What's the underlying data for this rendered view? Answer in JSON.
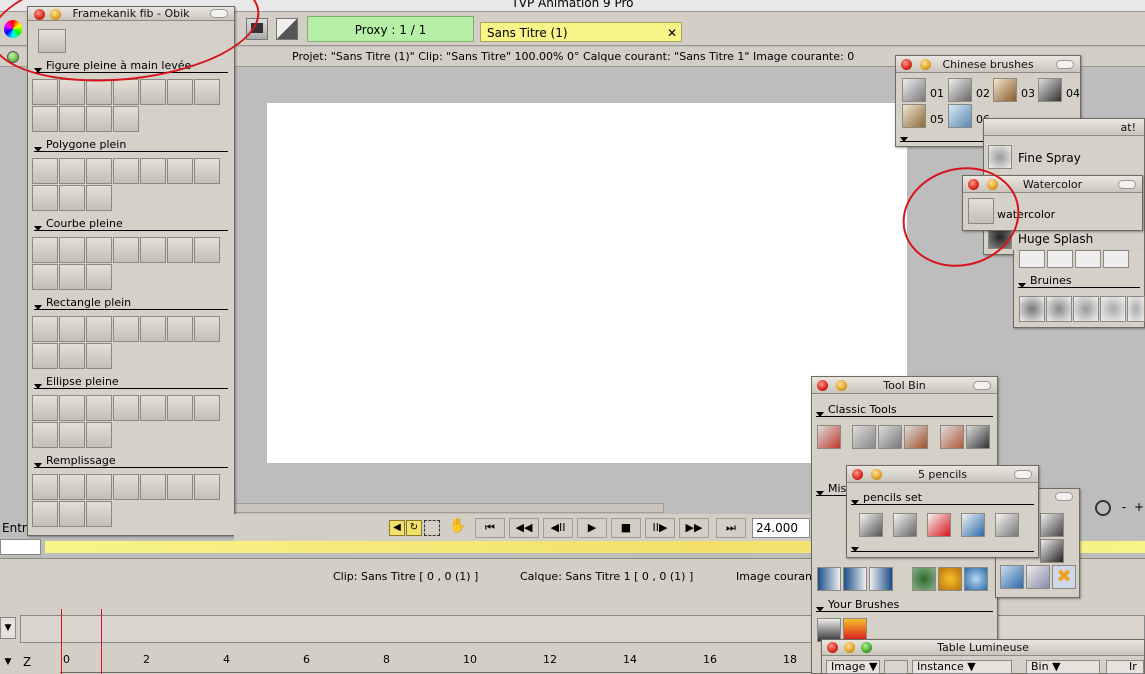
{
  "app": {
    "window_title": "TVP Animation 9 Pro"
  },
  "topbar": {
    "proxy_label": "Proxy : 1 / 1",
    "project_tab": "Sans Titre (1)",
    "tab_close": "✕"
  },
  "infobar": {
    "text": "Projet:  \"Sans Titre (1)\"  Clip: \"Sans Titre\"   100.00%   0°  Calque courant: \"Sans Titre 1\"  Image courante: 0"
  },
  "left_panel": {
    "title": "Framekanik fib - Obik",
    "sections": [
      "Figure pleine à main levée",
      "Polygone plein",
      "Courbe pleine",
      "Rectangle plein",
      "Ellipse pleine",
      "Remplissage"
    ]
  },
  "chinese_brushes": {
    "title": "Chinese brushes",
    "items": [
      "01",
      "02",
      "03",
      "04",
      "05",
      "06"
    ]
  },
  "splat_panel": {
    "title_partial": "at!",
    "items": [
      "Fine Spray",
      "Huge Splash"
    ],
    "section": "Bruines"
  },
  "watercolor": {
    "title": "Watercolor",
    "item": "watercolor"
  },
  "tool_bin": {
    "title": "Tool Bin",
    "sections": [
      "Classic Tools",
      "Mis",
      "Your Brushes"
    ]
  },
  "pencils": {
    "title": "5 pencils",
    "section": "pencils set"
  },
  "transport": {
    "fps": "24.000",
    "buttons": [
      "⏮",
      "◀◀",
      "◀II",
      "▶",
      "■",
      "II▶",
      "▶▶",
      "⏭"
    ]
  },
  "timeline": {
    "status_clip": "Clip: Sans Titre [ 0 , 0  (1) ]",
    "status_layer": "Calque: Sans Titre 1 [ 0 , 0  (1) ]",
    "status_image": "Image couran",
    "entry_label": "Entr",
    "ruler": [
      "0",
      "2",
      "4",
      "6",
      "8",
      "10",
      "12",
      "14",
      "16",
      "18"
    ],
    "z_label": "Z"
  },
  "table_lumineuse": {
    "title": "Table Lumineuse",
    "col_image": "Image",
    "col_instance": "Instance",
    "col_bin": "Bin",
    "col_extra": "Ir"
  },
  "colors": {
    "annotation_red": "#d8141d",
    "proxy_green": "#b5f0a6",
    "tab_yellow": "#f7f48a"
  }
}
